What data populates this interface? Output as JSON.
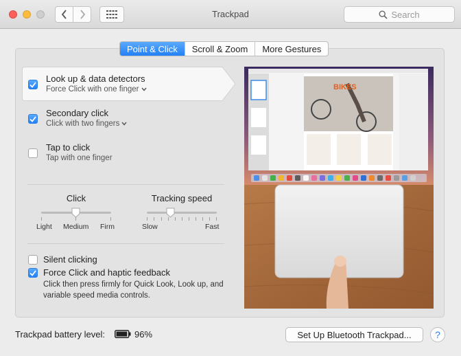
{
  "window": {
    "title": "Trackpad"
  },
  "search": {
    "placeholder": "Search"
  },
  "tabs": [
    {
      "label": "Point & Click",
      "active": true
    },
    {
      "label": "Scroll & Zoom",
      "active": false
    },
    {
      "label": "More Gestures",
      "active": false
    }
  ],
  "features": [
    {
      "title": "Look up & data detectors",
      "subtitle": "Force Click with one finger",
      "checked": true,
      "has_dropdown": true
    },
    {
      "title": "Secondary click",
      "subtitle": "Click with two fingers",
      "checked": true,
      "has_dropdown": true
    },
    {
      "title": "Tap to click",
      "subtitle": "Tap with one finger",
      "checked": false,
      "has_dropdown": false
    }
  ],
  "sliders": {
    "click": {
      "title": "Click",
      "labels": [
        "Light",
        "Medium",
        "Firm"
      ],
      "value_fraction": 0.5
    },
    "tracking": {
      "title": "Tracking speed",
      "labels": [
        "Slow",
        "Fast"
      ],
      "value_fraction": 0.33
    }
  },
  "options": {
    "silent_clicking": {
      "label": "Silent clicking",
      "checked": false
    },
    "force_click": {
      "label": "Force Click and haptic feedback",
      "checked": true,
      "description": "Click then press firmly for Quick Look, Look up, and variable speed media controls."
    }
  },
  "preview": {
    "doc_heading": "BIKES"
  },
  "footer": {
    "battery_label": "Trackpad battery level:",
    "battery_percent": "96%",
    "battery_level": 0.96,
    "setup_button": "Set Up Bluetooth Trackpad...",
    "help_label": "?"
  },
  "colors": {
    "accent": "#2380f6",
    "close": "#fc605c",
    "minimize": "#fdbc40"
  }
}
